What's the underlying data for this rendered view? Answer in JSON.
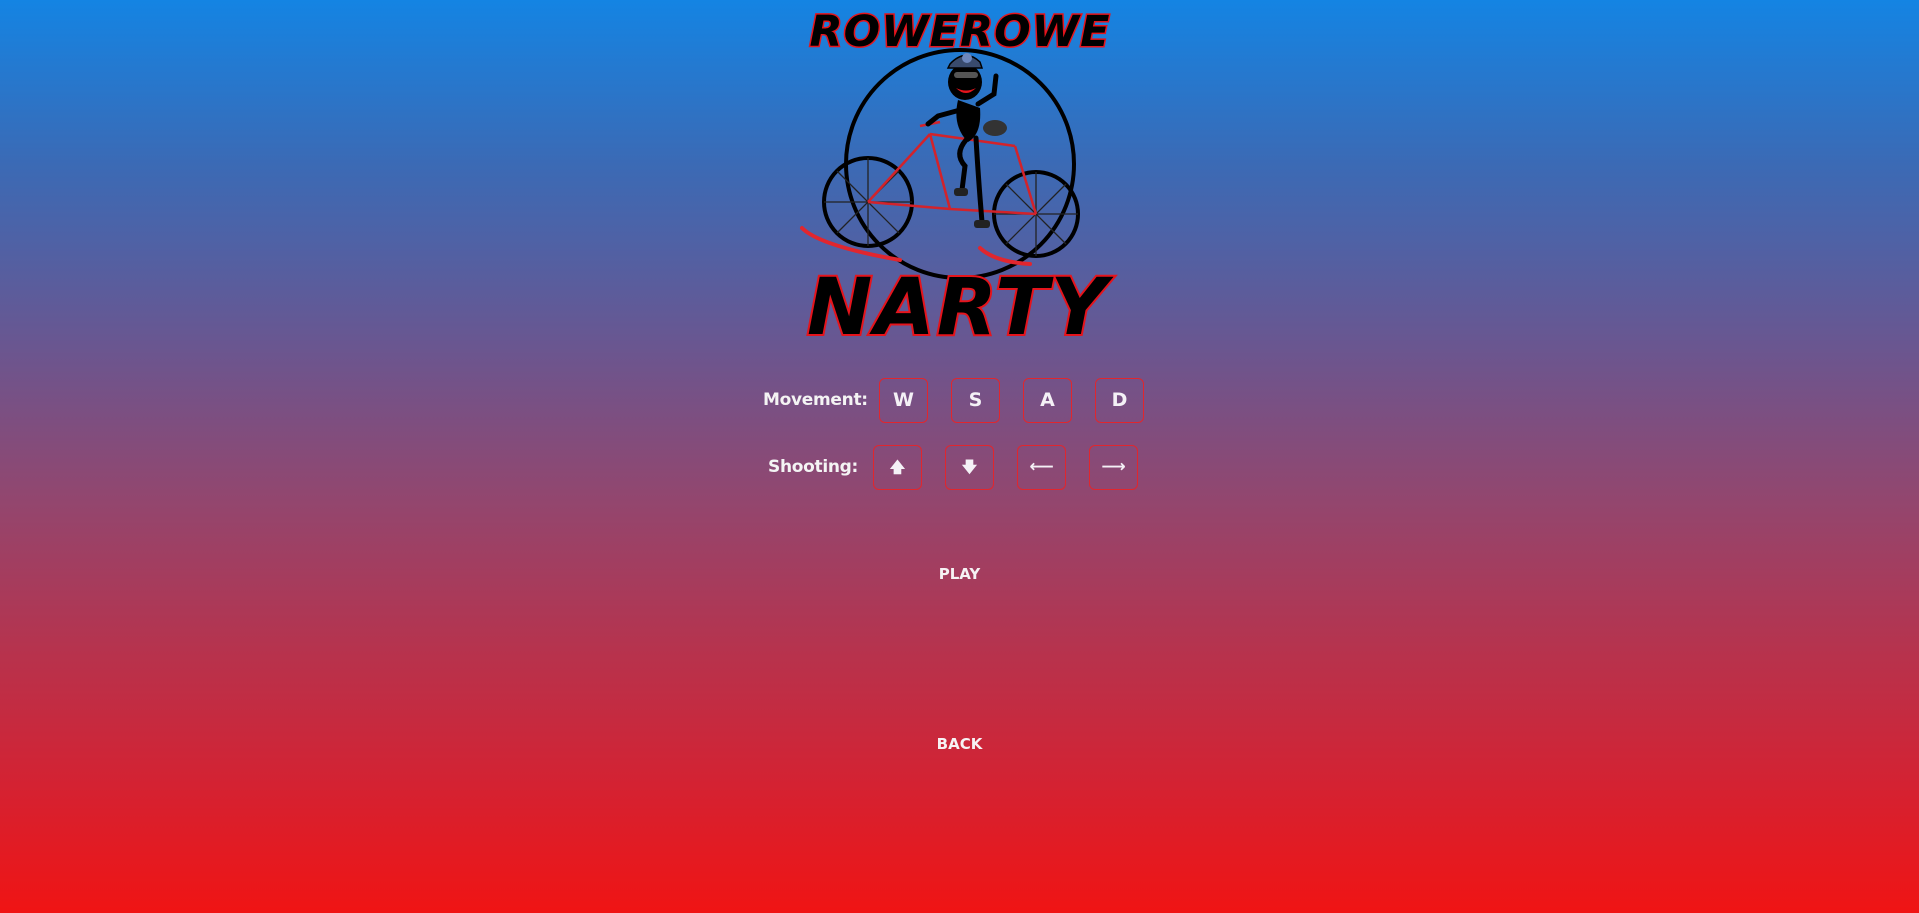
{
  "game": {
    "logo": {
      "top_text": "ROWEROWE",
      "bottom_text": "NARTY"
    },
    "controls": {
      "movement": {
        "label": "Movement:",
        "keys": [
          "W",
          "S",
          "A",
          "D"
        ]
      },
      "shooting": {
        "label": "Shooting:",
        "keys": [
          {
            "name": "arrow-up",
            "glyph": "🡅"
          },
          {
            "name": "arrow-down",
            "glyph": "🡇"
          },
          {
            "name": "arrow-left",
            "glyph": "⟵"
          },
          {
            "name": "arrow-right",
            "glyph": "⟶"
          }
        ]
      }
    },
    "menu": {
      "play_label": "PLAY",
      "back_label": "BACK"
    },
    "colors": {
      "gradient_top": "#1484e3",
      "gradient_bottom": "#f01414",
      "key_border": "#e1262e",
      "logo_text_stroke": "#e5141c"
    }
  }
}
